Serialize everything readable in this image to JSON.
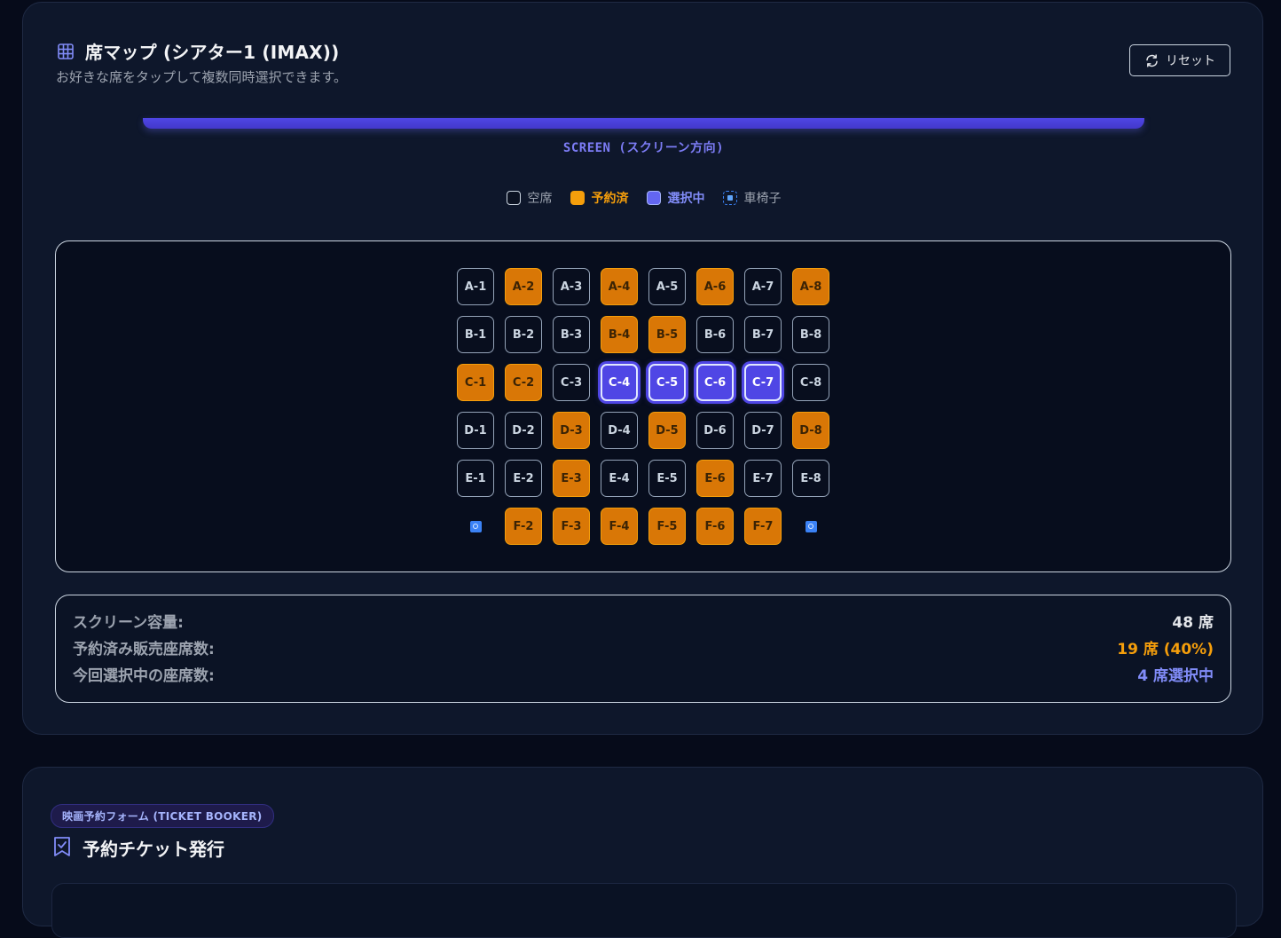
{
  "seat_map": {
    "title": "席マップ (シアター1 (IMAX))",
    "subtitle": "お好きな席をタップして複数同時選択できます。",
    "reset_label": "リセット",
    "screen_label": "SCREEN (スクリーン方向)",
    "legend": {
      "empty": "空席",
      "reserved": "予約済",
      "selected": "選択中",
      "wheelchair": "車椅子"
    },
    "rows": [
      [
        {
          "label": "A-1",
          "status": "empty"
        },
        {
          "label": "A-2",
          "status": "reserved"
        },
        {
          "label": "A-3",
          "status": "empty"
        },
        {
          "label": "A-4",
          "status": "reserved"
        },
        {
          "label": "A-5",
          "status": "empty"
        },
        {
          "label": "A-6",
          "status": "reserved"
        },
        {
          "label": "A-7",
          "status": "empty"
        },
        {
          "label": "A-8",
          "status": "reserved"
        }
      ],
      [
        {
          "label": "B-1",
          "status": "empty"
        },
        {
          "label": "B-2",
          "status": "empty"
        },
        {
          "label": "B-3",
          "status": "empty"
        },
        {
          "label": "B-4",
          "status": "reserved"
        },
        {
          "label": "B-5",
          "status": "reserved"
        },
        {
          "label": "B-6",
          "status": "empty"
        },
        {
          "label": "B-7",
          "status": "empty"
        },
        {
          "label": "B-8",
          "status": "empty"
        }
      ],
      [
        {
          "label": "C-1",
          "status": "reserved"
        },
        {
          "label": "C-2",
          "status": "reserved"
        },
        {
          "label": "C-3",
          "status": "empty"
        },
        {
          "label": "C-4",
          "status": "selected"
        },
        {
          "label": "C-5",
          "status": "selected"
        },
        {
          "label": "C-6",
          "status": "selected"
        },
        {
          "label": "C-7",
          "status": "selected"
        },
        {
          "label": "C-8",
          "status": "empty"
        }
      ],
      [
        {
          "label": "D-1",
          "status": "empty"
        },
        {
          "label": "D-2",
          "status": "empty"
        },
        {
          "label": "D-3",
          "status": "reserved"
        },
        {
          "label": "D-4",
          "status": "empty"
        },
        {
          "label": "D-5",
          "status": "reserved"
        },
        {
          "label": "D-6",
          "status": "empty"
        },
        {
          "label": "D-7",
          "status": "empty"
        },
        {
          "label": "D-8",
          "status": "reserved"
        }
      ],
      [
        {
          "label": "E-1",
          "status": "empty"
        },
        {
          "label": "E-2",
          "status": "empty"
        },
        {
          "label": "E-3",
          "status": "reserved"
        },
        {
          "label": "E-4",
          "status": "empty"
        },
        {
          "label": "E-5",
          "status": "empty"
        },
        {
          "label": "E-6",
          "status": "reserved"
        },
        {
          "label": "E-7",
          "status": "empty"
        },
        {
          "label": "E-8",
          "status": "empty"
        }
      ],
      [
        {
          "label": "",
          "status": "wheelchair"
        },
        {
          "label": "F-2",
          "status": "reserved"
        },
        {
          "label": "F-3",
          "status": "reserved"
        },
        {
          "label": "F-4",
          "status": "reserved"
        },
        {
          "label": "F-5",
          "status": "reserved"
        },
        {
          "label": "F-6",
          "status": "reserved"
        },
        {
          "label": "F-7",
          "status": "reserved"
        },
        {
          "label": "",
          "status": "wheelchair"
        }
      ]
    ],
    "stats": {
      "capacity_label": "スクリーン容量:",
      "capacity_value": "48 席",
      "reserved_label": "予約済み販売座席数:",
      "reserved_value": "19 席 (40%)",
      "selected_label": "今回選択中の座席数:",
      "selected_value": "4 席選択中"
    }
  },
  "booker": {
    "badge": "映画予約フォーム (TICKET BOOKER)",
    "title": "予約チケット発行"
  },
  "colors": {
    "accent": "#6366f1",
    "reserved": "#f59e0b",
    "background": "#060b1a",
    "card": "#0e172b"
  }
}
